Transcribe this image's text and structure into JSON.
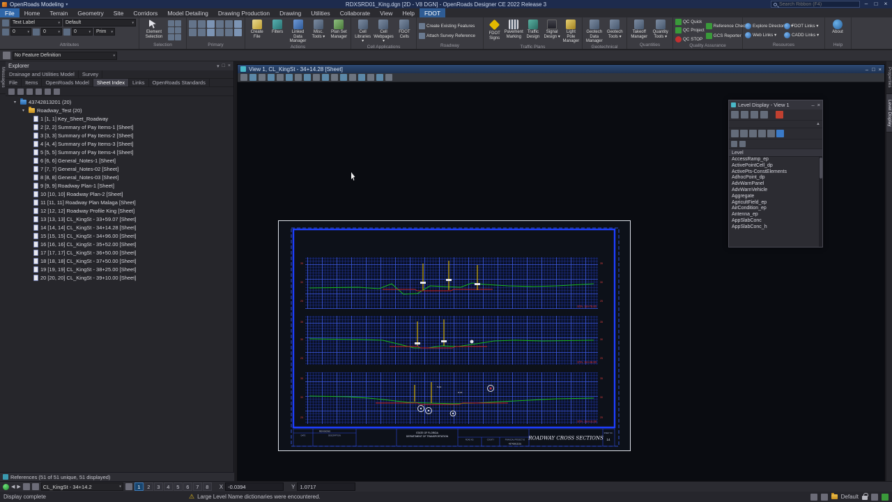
{
  "glyphs": {
    "dropdown": "▾",
    "caret": "▾",
    "minimize": "–",
    "maximize": "□",
    "close": "×",
    "warning": "⚠",
    "arrow_left": "◀",
    "arrow_right": "▶",
    "grid": "▦"
  },
  "titlebar": {
    "workflow": "OpenRoads Modeling",
    "title": "RDXSRD01_King.dgn [2D - V8 DGN] - OpenRoads Designer CE 2022 Release 3",
    "search_placeholder": "Search Ribbon (F4)",
    "quick_icons": [
      "open-icon",
      "save-icon",
      "undo-icon",
      "redo-icon",
      "print-icon"
    ]
  },
  "ribbon_tabs": [
    "File",
    "Home",
    "Terrain",
    "Geometry",
    "Site",
    "Corridors",
    "Model Detailing",
    "Drawing Production",
    "Drawing",
    "Utilities",
    "Collaborate",
    "View",
    "Help",
    "FDOT"
  ],
  "ribbon": {
    "group_labels": [
      "Attributes",
      "Selection",
      "Primary",
      "Actions",
      "Cell Applications",
      "Roadway",
      "Traffic Plans",
      "Geotechnical",
      "Quantities",
      "Quality Assurance",
      "Resources",
      "Help"
    ],
    "attributes": {
      "combo1": "Text Label",
      "combo2": "Default",
      "row2": [
        "0",
        "0",
        "0"
      ],
      "prim": "Prim"
    },
    "selection_label": "Element Selection",
    "selection_icons": [
      "fence-icon",
      "select-block-icon",
      "select-shape-icon",
      "select-line-icon",
      "select-point-icon",
      "fence-mode-icon"
    ],
    "primary_icons": [
      "explorer-icon",
      "attach-tools-icon",
      "models-icon",
      "level-manager-icon",
      "level-display-icon",
      "references-icon",
      "raster-manager-icon",
      "point-clouds-icon",
      "reality-mesh-icon",
      "markups-icon",
      "saved-views-icon",
      "properties-icon"
    ],
    "actions": [
      "Create File",
      "Filters",
      "Linked Data Manager",
      "Misc. Tools ▾",
      "Plan Set Manager"
    ],
    "cell_applications": [
      "Cell Libraries ▾",
      "Cell Webpages ▾",
      "FDOT Cells"
    ],
    "roadway": [
      "Create Existing Features",
      "Attach Survey Reference"
    ],
    "traffic_plans": [
      "FDOT Signs",
      "Pavement Marking",
      "Traffic Design",
      "Signal Design ▾",
      "Light Pole Manager"
    ],
    "geotechnical": [
      "Geotech Data Manager",
      "Geotech Tools ▾"
    ],
    "quantities": [
      "Takeoff Manager",
      "Quantity Tools ▾"
    ],
    "qa_col1": [
      "QC Quick",
      "QC Project",
      "QC STOP"
    ],
    "qa_col2": [
      "Reference Checker",
      "GCS Reporter"
    ],
    "resources": [
      "Explore Directories ▾",
      "FDOT Links ▾",
      "Web Links ▾",
      "CADD Links ▾"
    ],
    "help": [
      "About"
    ]
  },
  "toolbar2": {
    "feature_definition": "No Feature Definition",
    "icons": [
      "match-attributes-icon",
      "change-attributes-icon",
      "smart-match-icon",
      "feature-green-icon",
      "feature-red-icon",
      "lock-icon",
      "annotation-scale-icon",
      "acs-lock-icon",
      "graphic-group-icon",
      "level-lock-icon",
      "snap-lock-icon",
      "association-icon",
      "depth-lock-icon",
      "grid-lock-icon",
      "unit-lock-icon",
      "axis-lock-icon",
      "isometric-icon",
      "delete-icon",
      "close-x-icon",
      "measure-icon",
      "change-icon",
      "drop-icon",
      "group-icon",
      "selection-icon"
    ]
  },
  "dock_tabs": {
    "left": "Messages",
    "right_top": "Properties",
    "right_bottom": "Level Display"
  },
  "explorer": {
    "title": "Explorer",
    "tabs_row1": [
      "Drainage and Utilities Model",
      "Survey"
    ],
    "tabs_row2": [
      "File",
      "Items",
      "OpenRoads Model",
      "Sheet Index",
      "Links",
      "OpenRoads Standards"
    ],
    "toolbar_icons": [
      "refresh-icon",
      "add-sheet-icon",
      "manage-sheets-icon",
      "filter-icon",
      "expand-all-icon",
      "settings-icon"
    ],
    "root": "43742813201 (20)",
    "folder": "Roadway_Test (20)",
    "leaves": [
      "1 [1, 1] Key_Sheet_Roadway",
      "2 [2, 2] Summary of Pay Items-1 [Sheet]",
      "3 [3, 3] Summary of Pay Items-2 [Sheet]",
      "4 [4, 4] Summary of Pay Items-3 [Sheet]",
      "5 [5, 5] Summary of Pay Items-4 [Sheet]",
      "6 [6, 6] General_Notes-1 [Sheet]",
      "7 [7, 7] General_Notes-02 [Sheet]",
      "8 [8, 8] General_Notes-03 [Sheet]",
      "9 [9, 9] Roadway Plan-1 [Sheet]",
      "10 [10, 10] Roadway Plan-2 [Sheet]",
      "11 [11, 11] Roadway Plan Malaga [Sheet]",
      "12 [12, 12] Roadway Profile King [Sheet]",
      "13 [13, 13] CL_KingSt - 33+59.07 [Sheet]",
      "14 [14, 14] CL_KingSt - 34+14.28 [Sheet]",
      "15 [15, 15] CL_KingSt - 34+96.00 [Sheet]",
      "16 [16, 16] CL_KingSt - 35+52.00 [Sheet]",
      "17 [17, 17] CL_KingSt - 36+50.00 [Sheet]",
      "18 [18, 18] CL_KingSt - 37+50.00 [Sheet]",
      "19 [19, 19] CL_KingSt - 38+25.00 [Sheet]",
      "20 [20, 20] CL_KingSt - 39+10.00 [Sheet]"
    ]
  },
  "references_bar": "References (51 of 51 unique, 51 displayed)",
  "view": {
    "title": "View 1, CL_KingSt - 34+14.28 [Sheet]",
    "toolbar_icons": [
      "view-attributes-icon",
      "display-style-icon",
      "adjust-colors-icon",
      "model-icon",
      "fit-view-icon",
      "window-area-icon",
      "zoom-in-icon",
      "zoom-out-icon",
      "pan-icon",
      "rotate-view-icon",
      "view-previous-icon",
      "view-next-icon",
      "copy-view-icon",
      "clip-volume-icon",
      "clip-mask-icon",
      "saved-views-icon",
      "camera-icon"
    ]
  },
  "sheet": {
    "main_title": "ROADWAY CROSS SECTIONS",
    "agency_line1": "STATE OF FLORIDA",
    "agency_line2": "DEPARTMENT OF TRANSPORTATION",
    "revisions_title": "REVISIONS",
    "col_date": "DATE",
    "col_description": "DESCRIPTION",
    "road_no_label": "ROAD NO.",
    "county_label": "COUNTY",
    "fpid_label": "FINANCIAL PROJECT ID",
    "fpid_value": "43742813201",
    "sheet_no_label": "SHEET NO.",
    "sheet_no_value": "14",
    "stations": [
      "STA. 34+75.00",
      "STA. 34+46.00",
      "STA. 34+14.28"
    ],
    "elevations": [
      "35",
      "30",
      "25"
    ],
    "annotations": [
      "S-14",
      "P-15"
    ]
  },
  "level_dialog": {
    "title": "Level Display - View 1",
    "toolbar1_icons": [
      "view-toggle-icon",
      "level-list-icon",
      "level-groups-icon",
      "apply-to-views-icon",
      "change-level-icon"
    ],
    "toolbar2_icons": [
      "show-target-icon",
      "update-levels-icon",
      "sync-levels-icon"
    ],
    "tab_icons": [
      "levels-tab-icon",
      "filters-tab-icon",
      "styles-tab-icon",
      "groups-tab-icon",
      "library-tab-icon",
      "display-tab-icon"
    ],
    "sub_icons": [
      "level-tree-icon",
      "level-flat-icon"
    ],
    "column": "Level",
    "levels": [
      "AccessRamp_ep",
      "ActivePointCell_dp",
      "ActivePts-ConstElements",
      "AdhocPoint_dp",
      "AdvWarnPanel",
      "AdvWarnVehicle",
      "Aggregate",
      "AgricultField_ep",
      "AirCondition_ep",
      "Antenna_ep",
      "AppSlabConc",
      "AppSlabConc_h"
    ]
  },
  "statusbar": {
    "left_icons": [
      "previous-view-group-icon",
      "next-view-group-icon",
      "view-group-icon",
      "open-view-group-icon"
    ],
    "view_selector": "CL_KingSt - 34+14.2",
    "view_numbers": [
      "1",
      "2",
      "3",
      "4",
      "5",
      "6",
      "7",
      "8"
    ],
    "x_label": "X",
    "x_value": "-0.0394",
    "y_label": "Y",
    "y_value": "1.0717"
  },
  "message_bar": {
    "left": "Display complete",
    "warning": "Large Level Name dictionaries were encountered.",
    "model": "Default",
    "right_icons": [
      "snap-mode-icon",
      "locks-icon",
      "active-model-icon",
      "selection-set-icon",
      "clipboard-icon",
      "status-green-icon"
    ]
  }
}
